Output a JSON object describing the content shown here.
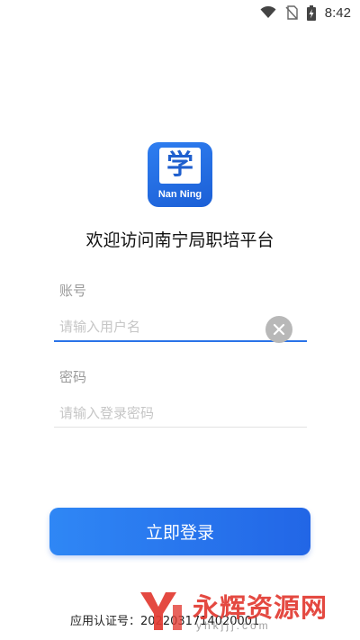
{
  "status_bar": {
    "time": "8:42"
  },
  "logo": {
    "glyph": "学",
    "wordmark": "Nan Ning",
    "color": "#2a73e8"
  },
  "welcome_text": "欢迎访问南宁局职培平台",
  "form": {
    "account": {
      "label": "账号",
      "placeholder": "请输入用户名",
      "value": ""
    },
    "password": {
      "label": "密码",
      "placeholder": "请输入登录密码",
      "value": ""
    },
    "login_label": "立即登录"
  },
  "footer": {
    "cert_label": "应用认证号：",
    "cert_number": "2022031714020001"
  },
  "watermark": {
    "text": "永辉资源网",
    "url": "yhkjjj.com"
  },
  "colors": {
    "accent": "#2a73e8",
    "button_start": "#2f87f5",
    "button_end": "#2266e6",
    "watermark": "#e23a31"
  }
}
